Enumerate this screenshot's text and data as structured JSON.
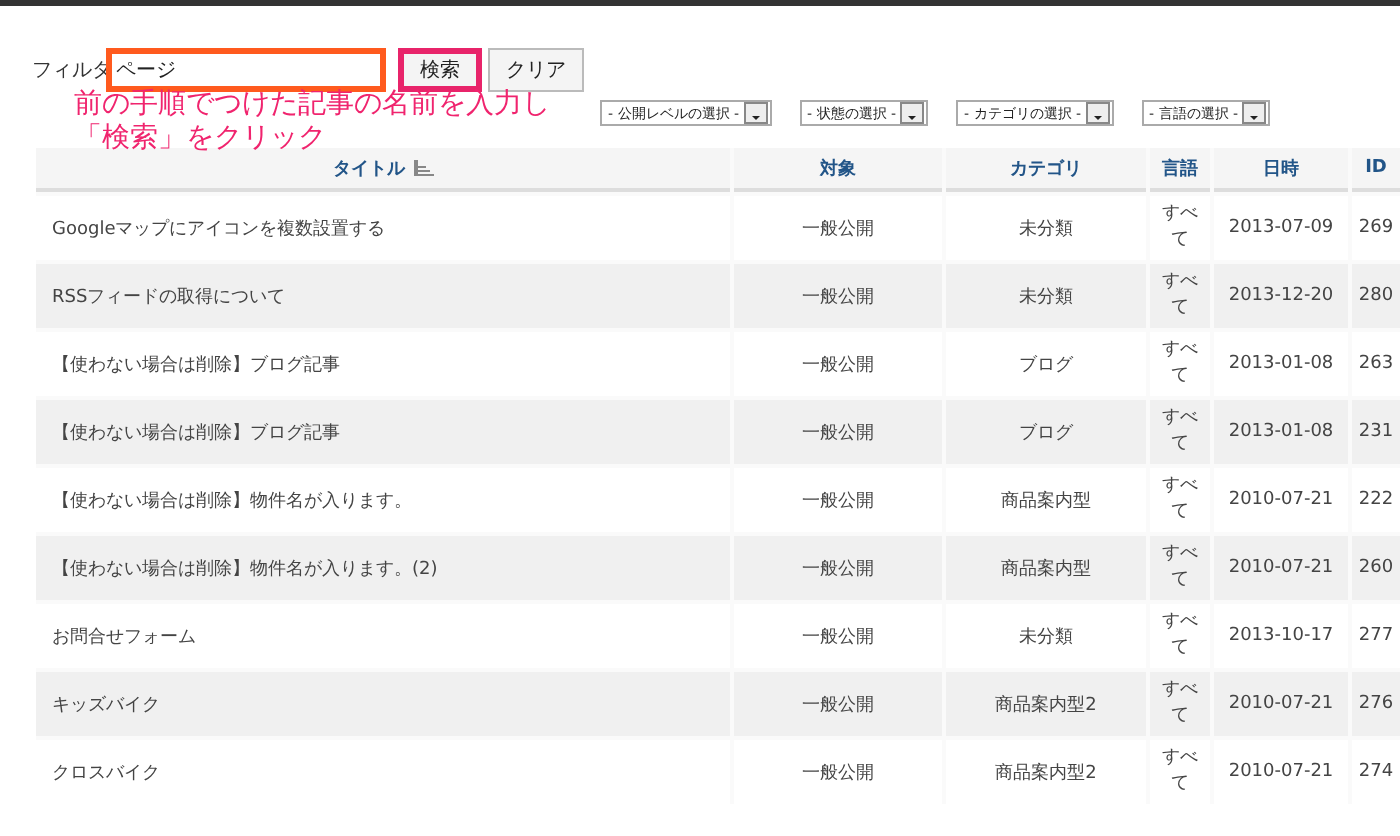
{
  "filter": {
    "label": "フィルタ",
    "value": "ページ",
    "buttons": [
      "検索",
      "クリア"
    ]
  },
  "annotation": {
    "lines": [
      "前の手順でつけた記事の名前を入力し",
      "「検索」をクリック"
    ]
  },
  "selects": [
    "- 公開レベルの選択 -",
    "- 状態の選択 -",
    "- カテゴリの選択 -",
    "- 言語の選択 -"
  ],
  "table": {
    "columns": [
      "タイトル",
      "対象",
      "カテゴリ",
      "言語",
      "日時",
      "ID"
    ],
    "rows": [
      [
        "Googleマップにアイコンを複数設置する",
        "一般公開",
        "未分類",
        "すべて",
        "2013-07-09",
        "269"
      ],
      [
        "RSSフィードの取得について",
        "一般公開",
        "未分類",
        "すべて",
        "2013-12-20",
        "280"
      ],
      [
        "【使わない場合は削除】ブログ記事",
        "一般公開",
        "ブログ",
        "すべて",
        "2013-01-08",
        "263"
      ],
      [
        "【使わない場合は削除】ブログ記事",
        "一般公開",
        "ブログ",
        "すべて",
        "2013-01-08",
        "231"
      ],
      [
        "【使わない場合は削除】物件名が入ります。",
        "一般公開",
        "商品案内型",
        "すべて",
        "2010-07-21",
        "222"
      ],
      [
        "【使わない場合は削除】物件名が入ります。(2)",
        "一般公開",
        "商品案内型",
        "すべて",
        "2010-07-21",
        "260"
      ],
      [
        "お問合せフォーム",
        "一般公開",
        "未分類",
        "すべて",
        "2013-10-17",
        "277"
      ],
      [
        "キッズバイク",
        "一般公開",
        "商品案内型2",
        "すべて",
        "2010-07-21",
        "276"
      ],
      [
        "クロスバイク",
        "一般公開",
        "商品案内型2",
        "すべて",
        "2010-07-21",
        "274"
      ]
    ]
  }
}
